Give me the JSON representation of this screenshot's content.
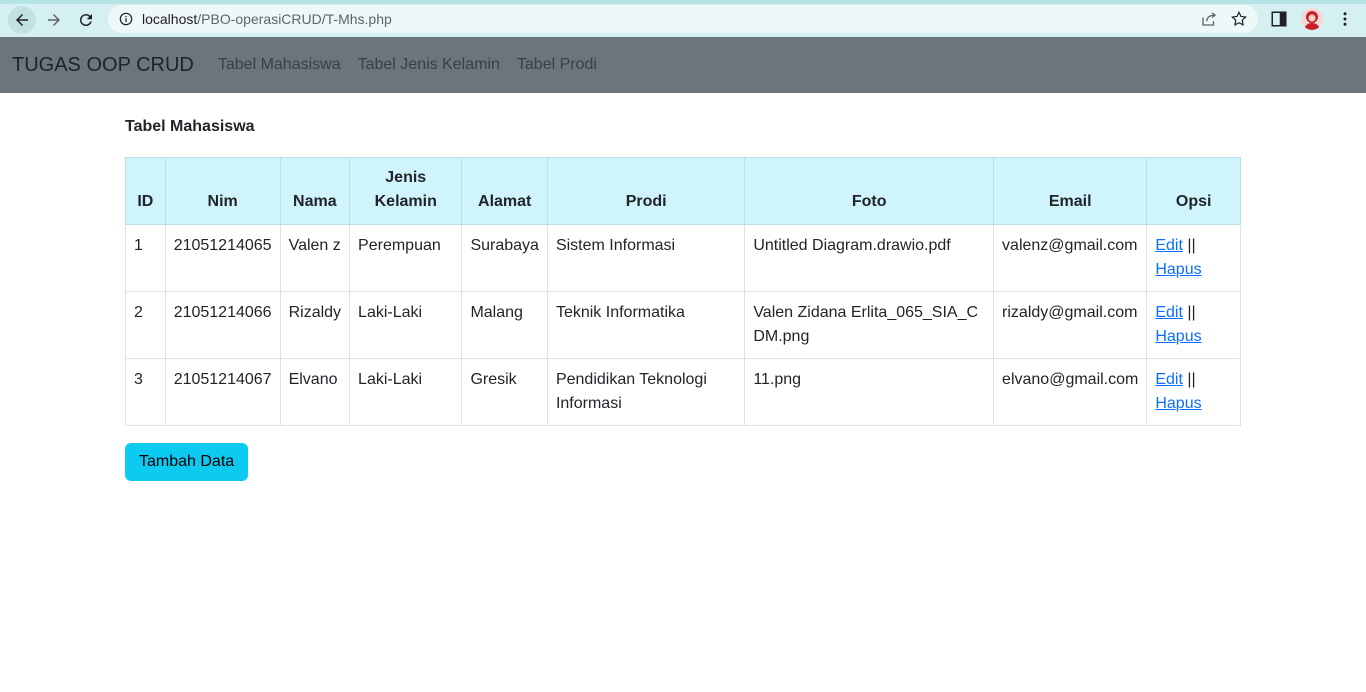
{
  "browser": {
    "url_host": "localhost",
    "url_path": "/PBO-operasiCRUD/T-Mhs.php"
  },
  "navbar": {
    "brand": "TUGAS OOP CRUD",
    "links": [
      "Tabel Mahasiswa",
      "Tabel Jenis Kelamin",
      "Tabel Prodi"
    ]
  },
  "main": {
    "title": "Tabel Mahasiswa",
    "headers": [
      "ID",
      "Nim",
      "Nama",
      "Jenis Kelamin",
      "Alamat",
      "Prodi",
      "Foto",
      "Email",
      "Opsi"
    ],
    "rows": [
      {
        "id": "1",
        "nim": "21051214065",
        "nama": "Valen z",
        "jk": "Perempuan",
        "alamat": "Surabaya",
        "prodi": "Sistem Informasi",
        "foto": "Untitled Diagram.drawio.pdf",
        "email": "valenz@gmail.com"
      },
      {
        "id": "2",
        "nim": "21051214066",
        "nama": "Rizaldy",
        "jk": "Laki-Laki",
        "alamat": "Malang",
        "prodi": "Teknik Informatika",
        "foto": "Valen Zidana Erlita_065_SIA_CDM.png",
        "email": "rizaldy@gmail.com"
      },
      {
        "id": "3",
        "nim": "21051214067",
        "nama": "Elvano",
        "jk": "Laki-Laki",
        "alamat": "Gresik",
        "prodi": "Pendidikan Teknologi Informasi",
        "foto": "11.png",
        "email": "elvano@gmail.com"
      }
    ],
    "edit_label": "Edit",
    "separator": "||",
    "delete_label": "Hapus",
    "add_button": "Tambah Data"
  },
  "colors": {
    "navbar_bg": "#6c757d",
    "header_bg": "#cff4fc",
    "button_bg": "#0dcaf0",
    "link": "#0d6efd"
  }
}
